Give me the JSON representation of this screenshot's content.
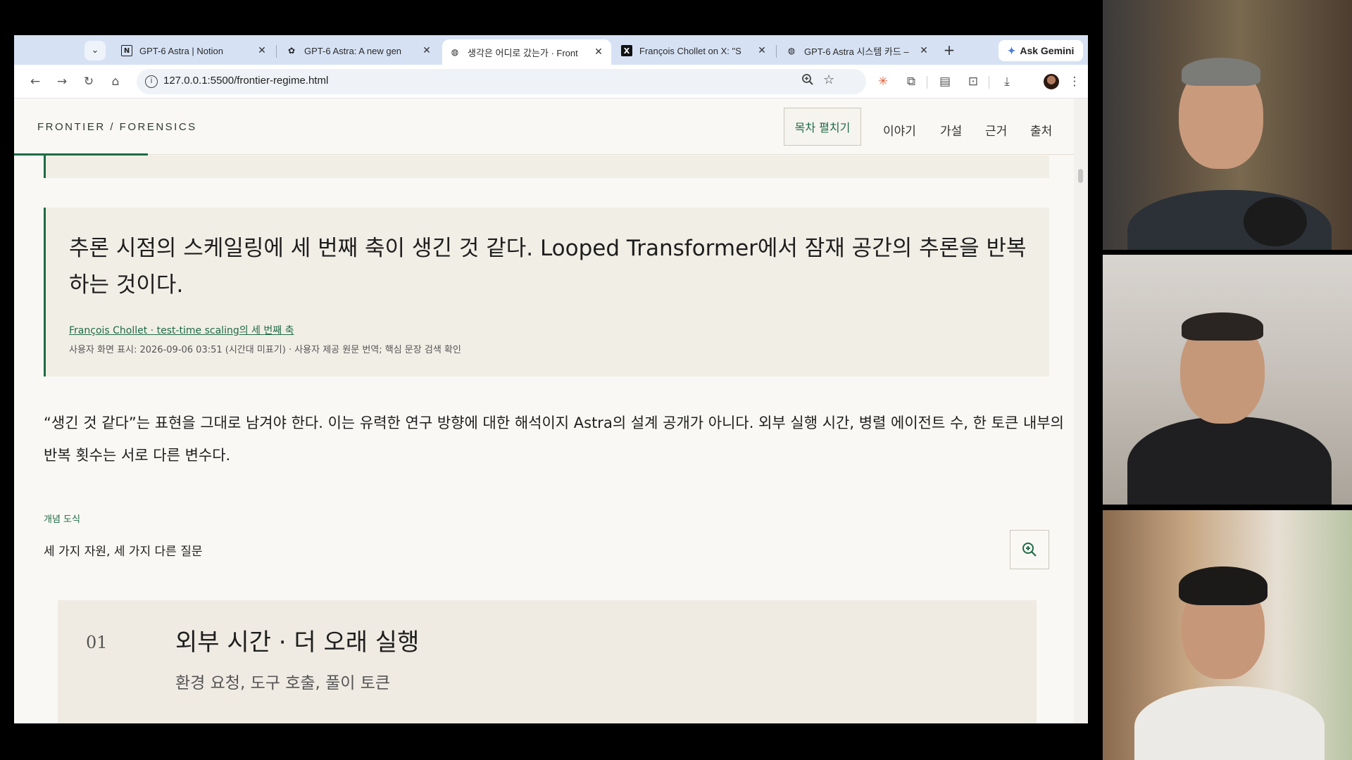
{
  "browser": {
    "tabs": [
      {
        "title": "GPT-6 Astra | Notion",
        "favicon": "notion-icon"
      },
      {
        "title": "GPT-6 Astra: A new gen",
        "favicon": "openai-icon"
      },
      {
        "title": "생각은 어디로 갔는가 · Front",
        "favicon": "globe-icon",
        "active": true
      },
      {
        "title": "François Chollet on X: \"S",
        "favicon": "x-icon"
      },
      {
        "title": "GPT-6 Astra 시스템 카드 –",
        "favicon": "globe-icon"
      }
    ],
    "ask_gemini": "Ask Gemini",
    "url": "127.0.0.1:5500/frontier-regime.html"
  },
  "header": {
    "brand": "FRONTIER / FORENSICS",
    "toc_button": "목차 펼치기",
    "nav": [
      "이야기",
      "가설",
      "근거",
      "출처"
    ]
  },
  "quote": {
    "text": "추론 시점의 스케일링에 세 번째 축이 생긴 것 같다. Looped Transformer에서 잠재 공간의 추론을 반복하는 것이다.",
    "source_link": "François Chollet · test-time scaling의 세 번째 축",
    "meta": "사용자 화면 표시: 2026-09-06 03:51 (시간대 미표기) · 사용자 제공 원문 번역; 핵심 문장 검색 확인"
  },
  "paragraph": "“생긴 것 같다”는 표현을 그대로 남겨야 한다. 이는 유력한 연구 방향에 대한 해석이지 Astra의 설계 공개가 아니다. 외부 실행 시간, 병렬 에이전트 수, 한 토큰 내부의 반복 횟수는 서로 다른 변수다.",
  "figure": {
    "label": "개념 도식",
    "title": "세 가지 자원, 세 가지 다른 질문"
  },
  "card": {
    "number": "01",
    "title": "외부 시간 · 더 오래 실행",
    "subtitle": "환경 요청, 도구 호출, 풀이 토큰"
  },
  "colors": {
    "accent": "#1f6b46",
    "page_bg": "#faf8f4",
    "quote_bg": "#f1eee6"
  }
}
